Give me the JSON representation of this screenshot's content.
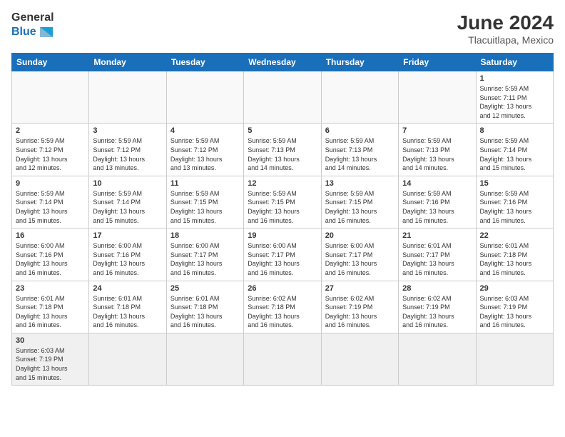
{
  "header": {
    "logo_general": "General",
    "logo_blue": "Blue",
    "month_year": "June 2024",
    "location": "Tlacuitlapa, Mexico"
  },
  "days_of_week": [
    "Sunday",
    "Monday",
    "Tuesday",
    "Wednesday",
    "Thursday",
    "Friday",
    "Saturday"
  ],
  "weeks": [
    [
      {
        "day": "",
        "info": ""
      },
      {
        "day": "",
        "info": ""
      },
      {
        "day": "",
        "info": ""
      },
      {
        "day": "",
        "info": ""
      },
      {
        "day": "",
        "info": ""
      },
      {
        "day": "",
        "info": ""
      },
      {
        "day": "1",
        "info": "Sunrise: 5:59 AM\nSunset: 7:11 PM\nDaylight: 13 hours\nand 12 minutes."
      }
    ],
    [
      {
        "day": "2",
        "info": "Sunrise: 5:59 AM\nSunset: 7:12 PM\nDaylight: 13 hours\nand 12 minutes."
      },
      {
        "day": "3",
        "info": "Sunrise: 5:59 AM\nSunset: 7:12 PM\nDaylight: 13 hours\nand 13 minutes."
      },
      {
        "day": "4",
        "info": "Sunrise: 5:59 AM\nSunset: 7:12 PM\nDaylight: 13 hours\nand 13 minutes."
      },
      {
        "day": "5",
        "info": "Sunrise: 5:59 AM\nSunset: 7:13 PM\nDaylight: 13 hours\nand 14 minutes."
      },
      {
        "day": "6",
        "info": "Sunrise: 5:59 AM\nSunset: 7:13 PM\nDaylight: 13 hours\nand 14 minutes."
      },
      {
        "day": "7",
        "info": "Sunrise: 5:59 AM\nSunset: 7:13 PM\nDaylight: 13 hours\nand 14 minutes."
      },
      {
        "day": "8",
        "info": "Sunrise: 5:59 AM\nSunset: 7:14 PM\nDaylight: 13 hours\nand 15 minutes."
      }
    ],
    [
      {
        "day": "9",
        "info": "Sunrise: 5:59 AM\nSunset: 7:14 PM\nDaylight: 13 hours\nand 15 minutes."
      },
      {
        "day": "10",
        "info": "Sunrise: 5:59 AM\nSunset: 7:14 PM\nDaylight: 13 hours\nand 15 minutes."
      },
      {
        "day": "11",
        "info": "Sunrise: 5:59 AM\nSunset: 7:15 PM\nDaylight: 13 hours\nand 15 minutes."
      },
      {
        "day": "12",
        "info": "Sunrise: 5:59 AM\nSunset: 7:15 PM\nDaylight: 13 hours\nand 16 minutes."
      },
      {
        "day": "13",
        "info": "Sunrise: 5:59 AM\nSunset: 7:15 PM\nDaylight: 13 hours\nand 16 minutes."
      },
      {
        "day": "14",
        "info": "Sunrise: 5:59 AM\nSunset: 7:16 PM\nDaylight: 13 hours\nand 16 minutes."
      },
      {
        "day": "15",
        "info": "Sunrise: 5:59 AM\nSunset: 7:16 PM\nDaylight: 13 hours\nand 16 minutes."
      }
    ],
    [
      {
        "day": "16",
        "info": "Sunrise: 6:00 AM\nSunset: 7:16 PM\nDaylight: 13 hours\nand 16 minutes."
      },
      {
        "day": "17",
        "info": "Sunrise: 6:00 AM\nSunset: 7:16 PM\nDaylight: 13 hours\nand 16 minutes."
      },
      {
        "day": "18",
        "info": "Sunrise: 6:00 AM\nSunset: 7:17 PM\nDaylight: 13 hours\nand 16 minutes."
      },
      {
        "day": "19",
        "info": "Sunrise: 6:00 AM\nSunset: 7:17 PM\nDaylight: 13 hours\nand 16 minutes."
      },
      {
        "day": "20",
        "info": "Sunrise: 6:00 AM\nSunset: 7:17 PM\nDaylight: 13 hours\nand 16 minutes."
      },
      {
        "day": "21",
        "info": "Sunrise: 6:01 AM\nSunset: 7:17 PM\nDaylight: 13 hours\nand 16 minutes."
      },
      {
        "day": "22",
        "info": "Sunrise: 6:01 AM\nSunset: 7:18 PM\nDaylight: 13 hours\nand 16 minutes."
      }
    ],
    [
      {
        "day": "23",
        "info": "Sunrise: 6:01 AM\nSunset: 7:18 PM\nDaylight: 13 hours\nand 16 minutes."
      },
      {
        "day": "24",
        "info": "Sunrise: 6:01 AM\nSunset: 7:18 PM\nDaylight: 13 hours\nand 16 minutes."
      },
      {
        "day": "25",
        "info": "Sunrise: 6:01 AM\nSunset: 7:18 PM\nDaylight: 13 hours\nand 16 minutes."
      },
      {
        "day": "26",
        "info": "Sunrise: 6:02 AM\nSunset: 7:18 PM\nDaylight: 13 hours\nand 16 minutes."
      },
      {
        "day": "27",
        "info": "Sunrise: 6:02 AM\nSunset: 7:19 PM\nDaylight: 13 hours\nand 16 minutes."
      },
      {
        "day": "28",
        "info": "Sunrise: 6:02 AM\nSunset: 7:19 PM\nDaylight: 13 hours\nand 16 minutes."
      },
      {
        "day": "29",
        "info": "Sunrise: 6:03 AM\nSunset: 7:19 PM\nDaylight: 13 hours\nand 16 minutes."
      }
    ],
    [
      {
        "day": "30",
        "info": "Sunrise: 6:03 AM\nSunset: 7:19 PM\nDaylight: 13 hours\nand 15 minutes."
      },
      {
        "day": "",
        "info": ""
      },
      {
        "day": "",
        "info": ""
      },
      {
        "day": "",
        "info": ""
      },
      {
        "day": "",
        "info": ""
      },
      {
        "day": "",
        "info": ""
      },
      {
        "day": "",
        "info": ""
      }
    ]
  ]
}
